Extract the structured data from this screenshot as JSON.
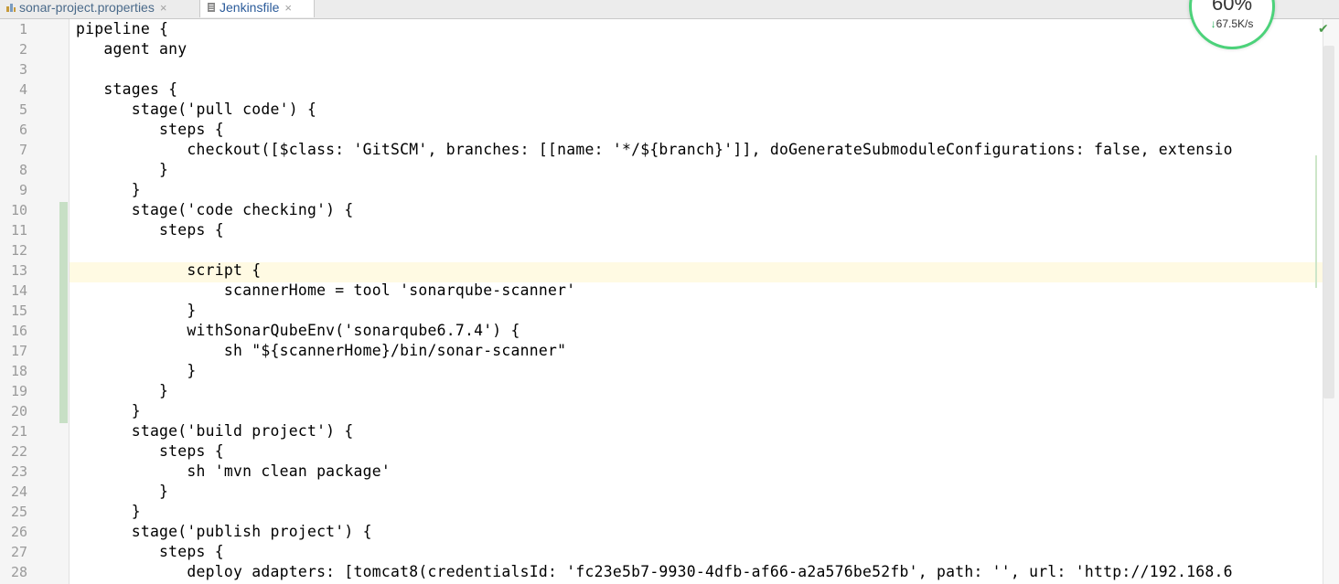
{
  "tabs": [
    {
      "label": "sonar-project.properties",
      "icon": "properties-file-icon",
      "close": "×",
      "active": false
    },
    {
      "label": "Jenkinsfile",
      "icon": "groovy-file-icon",
      "close": "×",
      "active": true
    }
  ],
  "net_monitor": {
    "percent": "60%",
    "arrow": "↓",
    "speed": "67.5K/s"
  },
  "editor": {
    "caret_line": 14,
    "lines": [
      {
        "n": "1",
        "text": "pipeline {"
      },
      {
        "n": "2",
        "text": "   agent any"
      },
      {
        "n": "3",
        "text": ""
      },
      {
        "n": "4",
        "text": "   stages {"
      },
      {
        "n": "5",
        "text": "      stage('pull code') {"
      },
      {
        "n": "6",
        "text": "         steps {"
      },
      {
        "n": "7",
        "text": "            checkout([$class: 'GitSCM', branches: [[name: '*/${branch}']], doGenerateSubmoduleConfigurations: false, extensio"
      },
      {
        "n": "8",
        "text": "         }"
      },
      {
        "n": "9",
        "text": "      }"
      },
      {
        "n": "10",
        "text": "      stage('code checking') {"
      },
      {
        "n": "11",
        "text": "         steps {"
      },
      {
        "n": "12",
        "text": ""
      },
      {
        "n": "13",
        "text": "            script {"
      },
      {
        "n": "14",
        "text": "                scannerHome = tool 'sonarqube-scanner'"
      },
      {
        "n": "15",
        "text": "            }"
      },
      {
        "n": "16",
        "text": "            withSonarQubeEnv('sonarqube6.7.4') {"
      },
      {
        "n": "17",
        "text": "                sh \"${scannerHome}/bin/sonar-scanner\""
      },
      {
        "n": "18",
        "text": "            }"
      },
      {
        "n": "19",
        "text": "         }"
      },
      {
        "n": "20",
        "text": "      }"
      },
      {
        "n": "21",
        "text": "      stage('build project') {"
      },
      {
        "n": "22",
        "text": "         steps {"
      },
      {
        "n": "23",
        "text": "            sh 'mvn clean package'"
      },
      {
        "n": "24",
        "text": "         }"
      },
      {
        "n": "25",
        "text": "      }"
      },
      {
        "n": "26",
        "text": "      stage('publish project') {"
      },
      {
        "n": "27",
        "text": "         steps {"
      },
      {
        "n": "28",
        "text": "            deploy adapters: [tomcat8(credentialsId: 'fc23e5b7-9930-4dfb-af66-a2a576be52fb', path: '', url: 'http://192.168.6"
      }
    ]
  }
}
